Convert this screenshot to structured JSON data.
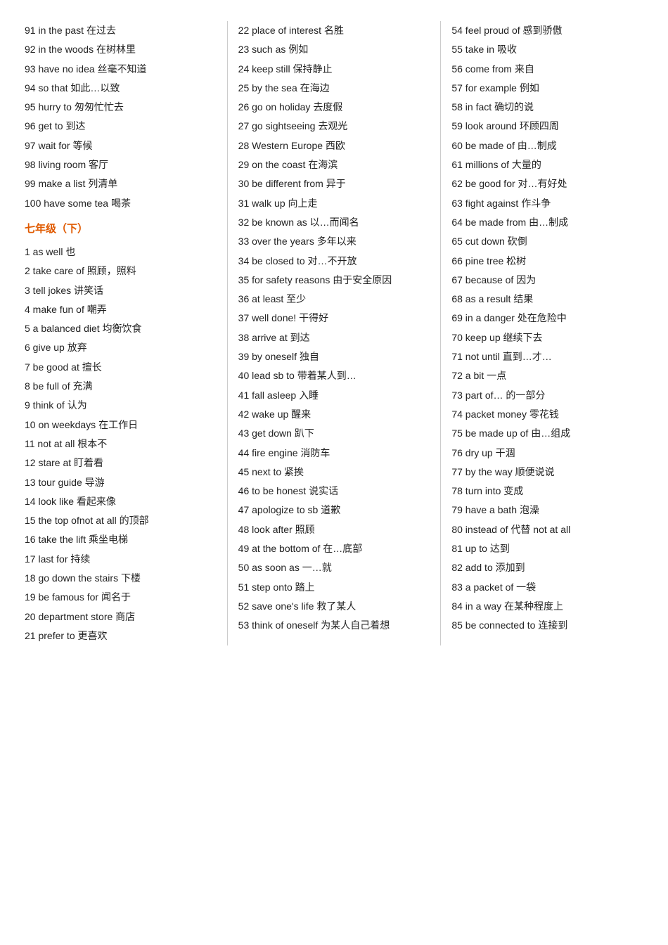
{
  "col1": {
    "items": [
      {
        "num": "91",
        "en": "in the past",
        "zh": "在过去"
      },
      {
        "num": "92",
        "en": "in the woods",
        "zh": "在树林里"
      },
      {
        "num": "93",
        "en": "have no idea",
        "zh": "丝毫不知道"
      },
      {
        "num": "94",
        "en": "so that",
        "zh": "如此…以致"
      },
      {
        "num": "95",
        "en": "hurry to",
        "zh": "匆匆忙忙去"
      },
      {
        "num": "96",
        "en": "get to",
        "zh": "到达"
      },
      {
        "num": "97",
        "en": "wait for",
        "zh": "等候"
      },
      {
        "num": "98",
        "en": "living room",
        "zh": "客厅"
      },
      {
        "num": "99",
        "en": "make a list",
        "zh": "列清单"
      },
      {
        "num": "100",
        "en": "have some tea",
        "zh": "喝茶"
      },
      {
        "num": "SECTION",
        "en": "七年级（下）",
        "zh": ""
      },
      {
        "num": "1",
        "en": "as well",
        "zh": "也"
      },
      {
        "num": "2",
        "en": "take care of",
        "zh": "照顾，照料"
      },
      {
        "num": "3",
        "en": "tell jokes",
        "zh": "讲笑话"
      },
      {
        "num": "4",
        "en": "make fun of",
        "zh": "嘲弄"
      },
      {
        "num": "5",
        "en": "a balanced diet",
        "zh": "均衡饮食"
      },
      {
        "num": "6",
        "en": "give up",
        "zh": "放弃"
      },
      {
        "num": "7",
        "en": "be good at",
        "zh": "擅长"
      },
      {
        "num": "8",
        "en": "be full of",
        "zh": "充满"
      },
      {
        "num": "9",
        "en": "think of",
        "zh": "认为"
      },
      {
        "num": "10",
        "en": "on weekdays",
        "zh": "在工作日"
      },
      {
        "num": "11",
        "en": "not at all",
        "zh": "根本不"
      },
      {
        "num": "12",
        "en": "stare at",
        "zh": "盯着看"
      },
      {
        "num": "13",
        "en": "tour guide",
        "zh": "导游"
      },
      {
        "num": "14",
        "en": "look like",
        "zh": "看起来像"
      },
      {
        "num": "15",
        "en": "the top ofnot at all",
        "zh": "的顶部"
      },
      {
        "num": "16",
        "en": "take the lift",
        "zh": "乘坐电梯"
      },
      {
        "num": "17",
        "en": "last for",
        "zh": "持续"
      },
      {
        "num": "18",
        "en": "go down the stairs",
        "zh": "下楼"
      },
      {
        "num": "19",
        "en": "be famous for",
        "zh": "闻名于"
      },
      {
        "num": "20",
        "en": "department store",
        "zh": "商店"
      },
      {
        "num": "21",
        "en": "prefer to",
        "zh": "更喜欢"
      }
    ]
  },
  "col2": {
    "items": [
      {
        "num": "22",
        "en": "place of interest",
        "zh": "名胜"
      },
      {
        "num": "23",
        "en": "such as",
        "zh": "例如"
      },
      {
        "num": "24",
        "en": "keep still",
        "zh": "保持静止"
      },
      {
        "num": "25",
        "en": "by the sea",
        "zh": "在海边"
      },
      {
        "num": "26",
        "en": "go on holiday",
        "zh": "去度假"
      },
      {
        "num": "27",
        "en": "go sightseeing",
        "zh": "去观光"
      },
      {
        "num": "28",
        "en": "Western Europe",
        "zh": "西欧"
      },
      {
        "num": "29",
        "en": "on the coast",
        "zh": "在海滨"
      },
      {
        "num": "30",
        "en": "be different from",
        "zh": "异于"
      },
      {
        "num": "31",
        "en": "walk up",
        "zh": "向上走"
      },
      {
        "num": "32",
        "en": "be known as",
        "zh": "以…而闻名"
      },
      {
        "num": "33",
        "en": "over the years",
        "zh": "多年以来"
      },
      {
        "num": "34",
        "en": "be closed to",
        "zh": "对…不开放"
      },
      {
        "num": "35",
        "en": "for safety reasons",
        "zh": "由于安全原因"
      },
      {
        "num": "36",
        "en": "at least",
        "zh": "至少"
      },
      {
        "num": "37",
        "en": "well done!",
        "zh": "干得好"
      },
      {
        "num": "38",
        "en": "arrive at",
        "zh": "到达"
      },
      {
        "num": "39",
        "en": "by oneself",
        "zh": "独自"
      },
      {
        "num": "40",
        "en": "lead sb to",
        "zh": "带着某人到…"
      },
      {
        "num": "41",
        "en": "fall asleep",
        "zh": "入睡"
      },
      {
        "num": "42",
        "en": "wake up",
        "zh": "醒来"
      },
      {
        "num": "43",
        "en": "get down",
        "zh": "趴下"
      },
      {
        "num": "44",
        "en": "fire engine",
        "zh": "消防车"
      },
      {
        "num": "45",
        "en": "next to",
        "zh": "紧挨"
      },
      {
        "num": "46",
        "en": "to be honest",
        "zh": "说实话"
      },
      {
        "num": "47",
        "en": "apologize to sb",
        "zh": "道歉"
      },
      {
        "num": "48",
        "en": "look after",
        "zh": "照顾"
      },
      {
        "num": "49",
        "en": "at the bottom of",
        "zh": "在…底部"
      },
      {
        "num": "50",
        "en": "as soon as",
        "zh": "一…就"
      },
      {
        "num": "51",
        "en": "step onto",
        "zh": "踏上"
      },
      {
        "num": "52",
        "en": "save one's life",
        "zh": "救了某人"
      },
      {
        "num": "53",
        "en": "think of oneself",
        "zh": "为某人自己着想"
      }
    ]
  },
  "col3": {
    "items": [
      {
        "num": "54",
        "en": "feel proud of",
        "zh": "感到骄傲"
      },
      {
        "num": "55",
        "en": "take in",
        "zh": "吸收"
      },
      {
        "num": "56",
        "en": "come from",
        "zh": "来自"
      },
      {
        "num": "57",
        "en": "for example",
        "zh": "例如"
      },
      {
        "num": "58",
        "en": "in fact",
        "zh": "确切的说"
      },
      {
        "num": "59",
        "en": "look around",
        "zh": "环顾四周"
      },
      {
        "num": "60",
        "en": "be made of",
        "zh": "由…制成"
      },
      {
        "num": "61",
        "en": "millions of",
        "zh": "大量的"
      },
      {
        "num": "62",
        "en": "be good for",
        "zh": "对…有好处"
      },
      {
        "num": "63",
        "en": "fight against",
        "zh": "作斗争"
      },
      {
        "num": "64",
        "en": "be made from",
        "zh": "由…制成"
      },
      {
        "num": "65",
        "en": "cut down",
        "zh": "砍倒"
      },
      {
        "num": "66",
        "en": "pine tree",
        "zh": "松树"
      },
      {
        "num": "67",
        "en": "because of",
        "zh": "因为"
      },
      {
        "num": "68",
        "en": "as a result",
        "zh": "结果"
      },
      {
        "num": "69",
        "en": "in a danger",
        "zh": "处在危险中"
      },
      {
        "num": "70",
        "en": "keep up",
        "zh": "继续下去"
      },
      {
        "num": "71",
        "en": "not until",
        "zh": "直到…才…"
      },
      {
        "num": "72",
        "en": "a bit",
        "zh": "一点"
      },
      {
        "num": "73",
        "en": "part of…",
        "zh": "的一部分"
      },
      {
        "num": "74",
        "en": "packet money",
        "zh": "零花钱"
      },
      {
        "num": "75",
        "en": "be made up of",
        "zh": "由…组成"
      },
      {
        "num": "76",
        "en": "dry up",
        "zh": "干涸"
      },
      {
        "num": "77",
        "en": "by the way",
        "zh": "顺便说说"
      },
      {
        "num": "78",
        "en": "turn into",
        "zh": "变成"
      },
      {
        "num": "79",
        "en": "have a bath",
        "zh": "泡澡"
      },
      {
        "num": "80",
        "en": "instead of",
        "zh": "代替 not at all"
      },
      {
        "num": "81",
        "en": "up to",
        "zh": "达到"
      },
      {
        "num": "82",
        "en": "add to",
        "zh": "添加到"
      },
      {
        "num": "83",
        "en": "a packet of",
        "zh": "一袋"
      },
      {
        "num": "84",
        "en": "in a way",
        "zh": "在某种程度上"
      },
      {
        "num": "85",
        "en": "be connected to",
        "zh": "连接到"
      }
    ]
  }
}
